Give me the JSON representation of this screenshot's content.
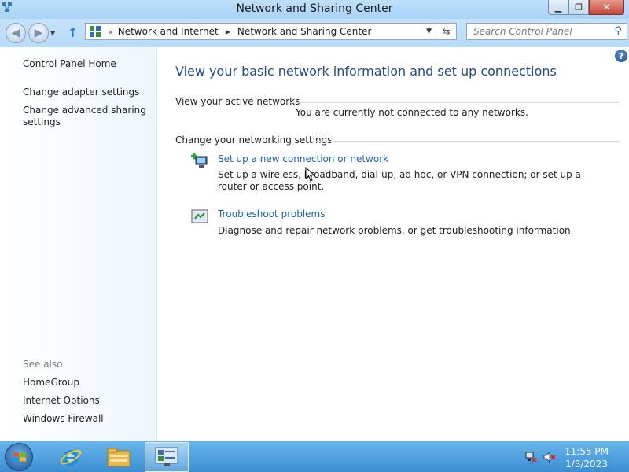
{
  "window": {
    "title": "Network and Sharing Center"
  },
  "titlebar": {
    "minimize_icon": "minimize-icon",
    "maximize_icon": "maximize-icon",
    "close_label": "✕"
  },
  "address_bar": {
    "overflow_label": "«",
    "breadcrumbs": [
      "Network and Internet",
      "Network and Sharing Center"
    ]
  },
  "search": {
    "placeholder": "Search Control Panel"
  },
  "sidebar": {
    "links": [
      "Control Panel Home",
      "Change adapter settings",
      "Change advanced sharing settings"
    ],
    "see_also_heading": "See also",
    "see_also_links": [
      "HomeGroup",
      "Internet Options",
      "Windows Firewall"
    ]
  },
  "main": {
    "title": "View your basic network information and set up connections",
    "active_networks_heading": "View your active networks",
    "active_networks_status": "You are currently not connected to any networks.",
    "settings_heading": "Change your networking settings",
    "tasks": [
      {
        "link": "Set up a new connection or network",
        "description": "Set up a wireless, broadband, dial-up, ad hoc, or VPN connection; or set up a router or access point.",
        "icon": "new-connection-icon"
      },
      {
        "link": "Troubleshoot problems",
        "description": "Diagnose and repair network problems, or get troubleshooting information.",
        "icon": "troubleshoot-icon"
      }
    ]
  },
  "taskbar": {
    "apps": [
      "internet-explorer-icon",
      "file-explorer-icon",
      "control-panel-icon"
    ],
    "clock_time": "11:55 PM",
    "clock_date": "1/3/2023"
  },
  "colors": {
    "link": "#1e64b4",
    "title": "#1e4a8a",
    "taskbar": "#3a8fd2"
  }
}
